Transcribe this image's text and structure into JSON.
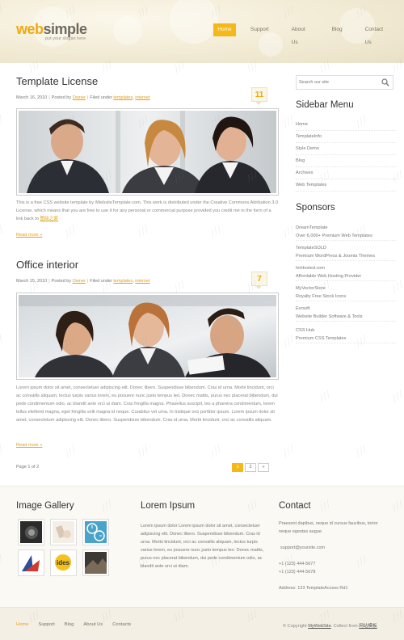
{
  "header": {
    "logo_web": "web",
    "logo_simple": "simple",
    "slogan": "put your slogan here",
    "nav": [
      {
        "label": "Home",
        "active": true
      },
      {
        "label": "Support",
        "active": false
      },
      {
        "label": "About Us",
        "active": false
      },
      {
        "label": "Blog",
        "active": false
      },
      {
        "label": "Contact Us",
        "active": false
      }
    ]
  },
  "posts": [
    {
      "title": "Template License",
      "date": "March 16, 2010",
      "posted_by_prefix": "Posted by",
      "author": "Owner",
      "filed_prefix": "Filed under",
      "cat1": "templates",
      "cat2": "internet",
      "badge": "11",
      "text": "This is a free CSS website template by iWebsiteTemplate.com. This work is distributed under the Creative Commons Attribution 3.0 License, which means that you are free to use it for any personal or commercial purpose provided you credit me in the form of a link back to",
      "link_text": "图绘之家",
      "read_more": "Read more »"
    },
    {
      "title": "Office interior",
      "date": "March 15, 2010",
      "posted_by_prefix": "Posted by",
      "author": "Owner",
      "filed_prefix": "Filed under",
      "cat1": "templates",
      "cat2": "internet",
      "badge": "7",
      "text": "Lorem ipsum dolor sit amet, consectetuer adipiscing elit. Donec libero. Suspendisse bibendum. Cras id urna. Morbi tincidunt, orci ac convallis aliquam, lectus turpis varius lorem, eu posuere nunc justo tempus leo. Donec mattis, purus nec placerat bibendum, dui pede condimentum odio, ac blandit ante orci ut diam. Cras fringilla magna. Phasellus suscipit, leo a pharetra condimentum, lorem tellus eleifend magna, eget fringilla velit magna id neque. Curabitur vel urna. In tristique orci porttitor ipsum. Lorem ipsum dolor sit amet, consectetuer adipiscing elit. Donec libero. Suspendisse bibendum. Cras id urna. Morbi tincidunt, orci ac convallis aliquam.",
      "read_more": "Read more »"
    }
  ],
  "pagination": {
    "label": "Page 1 of 2",
    "pages": [
      "1",
      "2",
      "»"
    ]
  },
  "sidebar": {
    "search_placeholder": "Search our site",
    "menu_title": "Sidebar Menu",
    "menu": [
      "Home",
      "TemplateInfo",
      "Style Demo",
      "Blog",
      "Archives",
      "Web Templates"
    ],
    "sponsors_title": "Sponsors",
    "sponsors": [
      {
        "name": "DreamTemplate",
        "desc": "Over 6,000+ Premium Web Templates"
      },
      {
        "name": "TemplateSOLD",
        "desc": "Premium WordPress & Joomla Themes"
      },
      {
        "name": "ImHosted.com",
        "desc": "Affordable Web Hosting Provider"
      },
      {
        "name": "MyVectorStore",
        "desc": "Royalty Free Stock Icons"
      },
      {
        "name": "Evrsoft",
        "desc": "Website Builder Software & Tools"
      },
      {
        "name": "CSS Hub",
        "desc": "Premium CSS Templates"
      }
    ]
  },
  "bottom": {
    "gallery_title": "Image Gallery",
    "lorem_title": "Lorem Ipsum",
    "lorem_text": "Lorem ipsum dolor Lorem ipsum dolor sit amet, consectetuer adipiscing elit. Donec libero. Suspendisse bibendum. Cras id urna. Morbi tincidunt, orci ac convallis aliquam, lectus turpis varius lorem, eu posuere nunc justo tempus leo. Donec mattis, purus nec placerat bibendum, dui pede condimentum odio, ac blandit ante orci ut diam.",
    "contact_title": "Contact",
    "contact_text": "Praesent dapibus, neque id cursus faucibus, tortor neque egestas augue.",
    "contact_email": "support@yoursite.com",
    "phone1": "+1 (123) 444-5677",
    "phone2": "+1 (123) 444-5678",
    "address": "Address: 123 TemplateAccess Rd1"
  },
  "footer": {
    "nav": [
      {
        "label": "Home",
        "active": true
      },
      {
        "label": "Support",
        "active": false
      },
      {
        "label": "Blog",
        "active": false
      },
      {
        "label": "About Us",
        "active": false
      },
      {
        "label": "Contacts",
        "active": false
      }
    ],
    "copyright_prefix": "© Copyright",
    "copyright_link": "MyWebSite",
    "collect_prefix": ". Collect from",
    "collect_link": "网站模板"
  },
  "colors": {
    "accent": "#f5b819",
    "link": "#e39d12",
    "heading": "#333333"
  }
}
